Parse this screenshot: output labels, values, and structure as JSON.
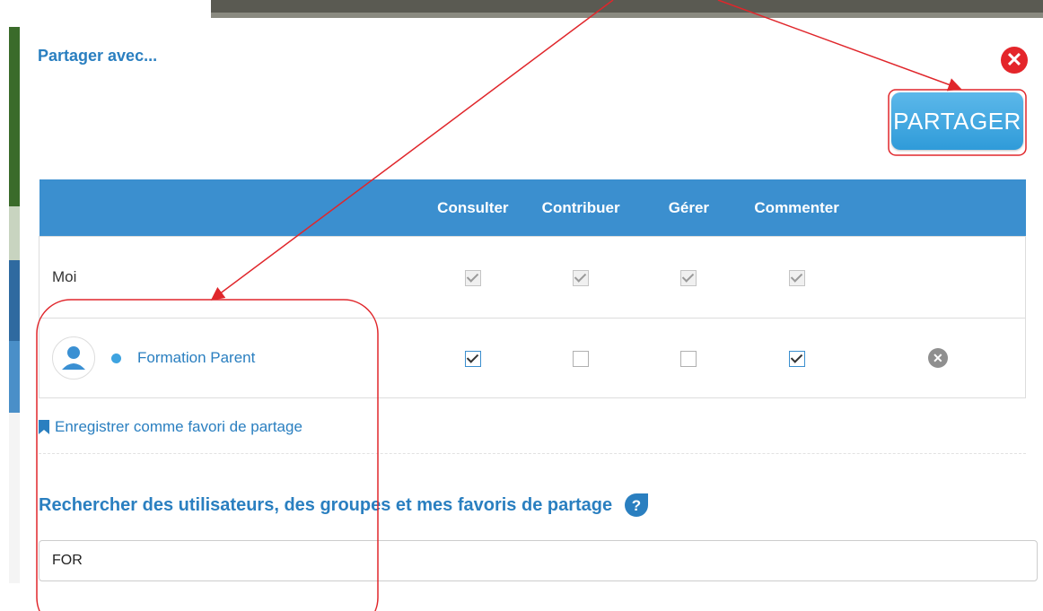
{
  "dialog": {
    "title": "Partager avec...",
    "close_icon": "close-icon",
    "share_button": "PARTAGER"
  },
  "table": {
    "headers": [
      "",
      "Consulter",
      "Contribuer",
      "Gérer",
      "Commenter",
      ""
    ],
    "rows": [
      {
        "name": "Moi",
        "consulter": true,
        "contribuer": true,
        "gerer": true,
        "commenter": true,
        "editable": false
      },
      {
        "name": "Formation Parent",
        "consulter": true,
        "contribuer": false,
        "gerer": false,
        "commenter": true,
        "editable": true,
        "icon": "user-avatar-icon"
      }
    ]
  },
  "favorite_link": "Enregistrer comme favori de partage",
  "search": {
    "title": "Rechercher des utilisateurs, des groupes et mes favoris de partage",
    "value": "FOR"
  },
  "colors": {
    "accent": "#2a7fc0",
    "header": "#3b8fcf",
    "share_button": "#3aa4e0",
    "close": "#e4252a",
    "annotation": "#e0262b"
  }
}
